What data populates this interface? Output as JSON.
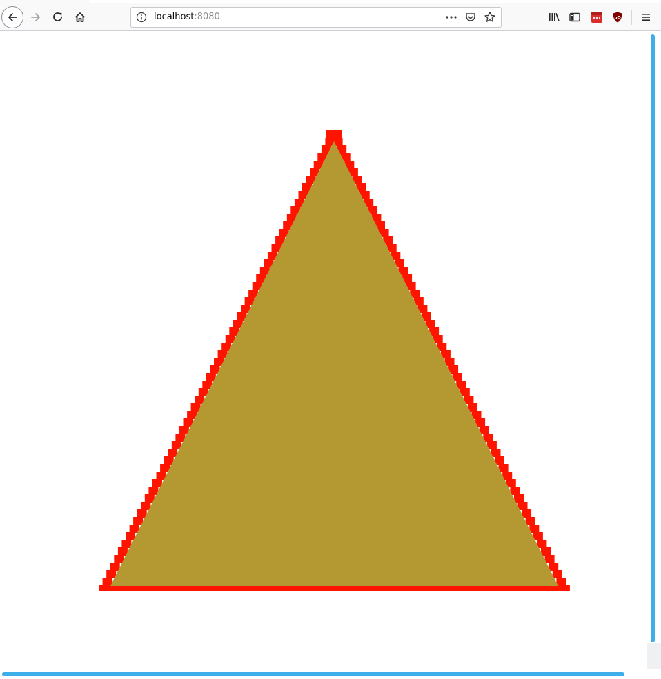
{
  "browser": {
    "url_host": "localhost",
    "url_port": ":8080",
    "toolbar_icons": [
      "back-icon",
      "forward-icon",
      "reload-icon",
      "home-icon",
      "info-icon",
      "more-icon",
      "pocket-icon",
      "star-icon",
      "library-icon",
      "sidebar-icon",
      "extension-icon",
      "ublock-icon",
      "menu-icon"
    ]
  },
  "scene": {
    "shape": "triangle",
    "fill_color": "#b49832",
    "edge_color": "#ff1400",
    "background": "#ffffff"
  },
  "colors": {
    "scrollbar_accent": "#3daee9",
    "extension_red": "#d92d2d",
    "ublock_red": "#800000"
  }
}
